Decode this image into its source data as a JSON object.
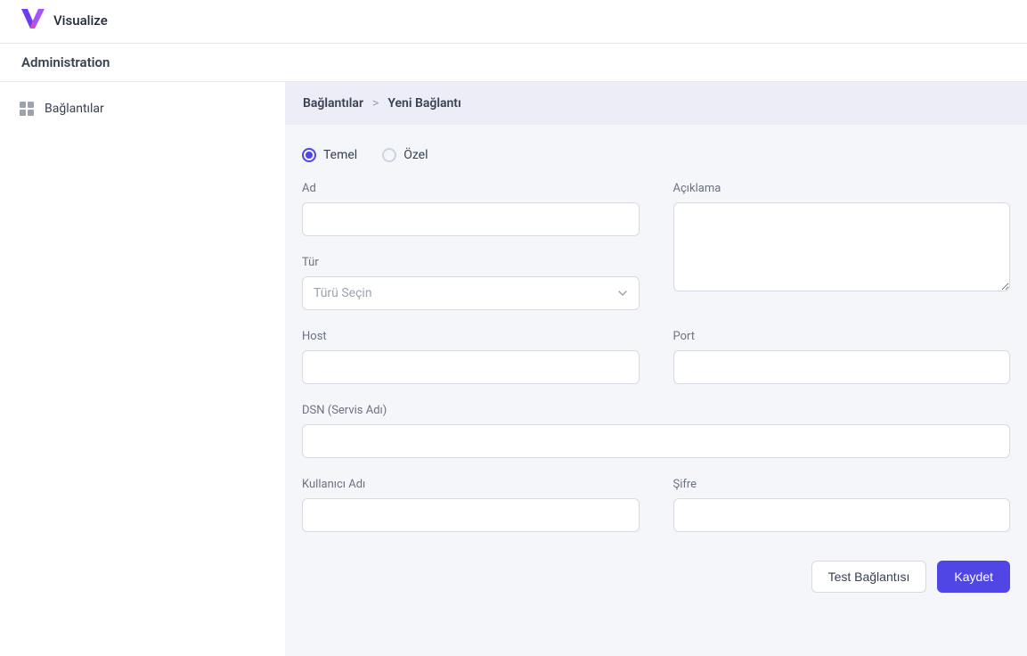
{
  "app": {
    "brand": "Visualize"
  },
  "admin": {
    "title": "Administration"
  },
  "sidebar": {
    "items": [
      {
        "label": "Bağlantılar"
      }
    ]
  },
  "breadcrumb": {
    "root": "Bağlantılar",
    "sep": ">",
    "current": "Yeni Bağlantı"
  },
  "radios": {
    "temel": "Temel",
    "ozel": "Özel",
    "selected": "temel"
  },
  "form": {
    "ad": {
      "label": "Ad",
      "value": ""
    },
    "aciklama": {
      "label": "Açıklama",
      "value": ""
    },
    "tur": {
      "label": "Tür",
      "placeholder": "Türü Seçin"
    },
    "host": {
      "label": "Host",
      "value": ""
    },
    "port": {
      "label": "Port",
      "value": ""
    },
    "dsn": {
      "label": "DSN (Servis Adı)",
      "value": ""
    },
    "kullanici": {
      "label": "Kullanıcı Adı",
      "value": ""
    },
    "sifre": {
      "label": "Şifre",
      "value": ""
    }
  },
  "actions": {
    "test": "Test Bağlantısı",
    "save": "Kaydet"
  }
}
